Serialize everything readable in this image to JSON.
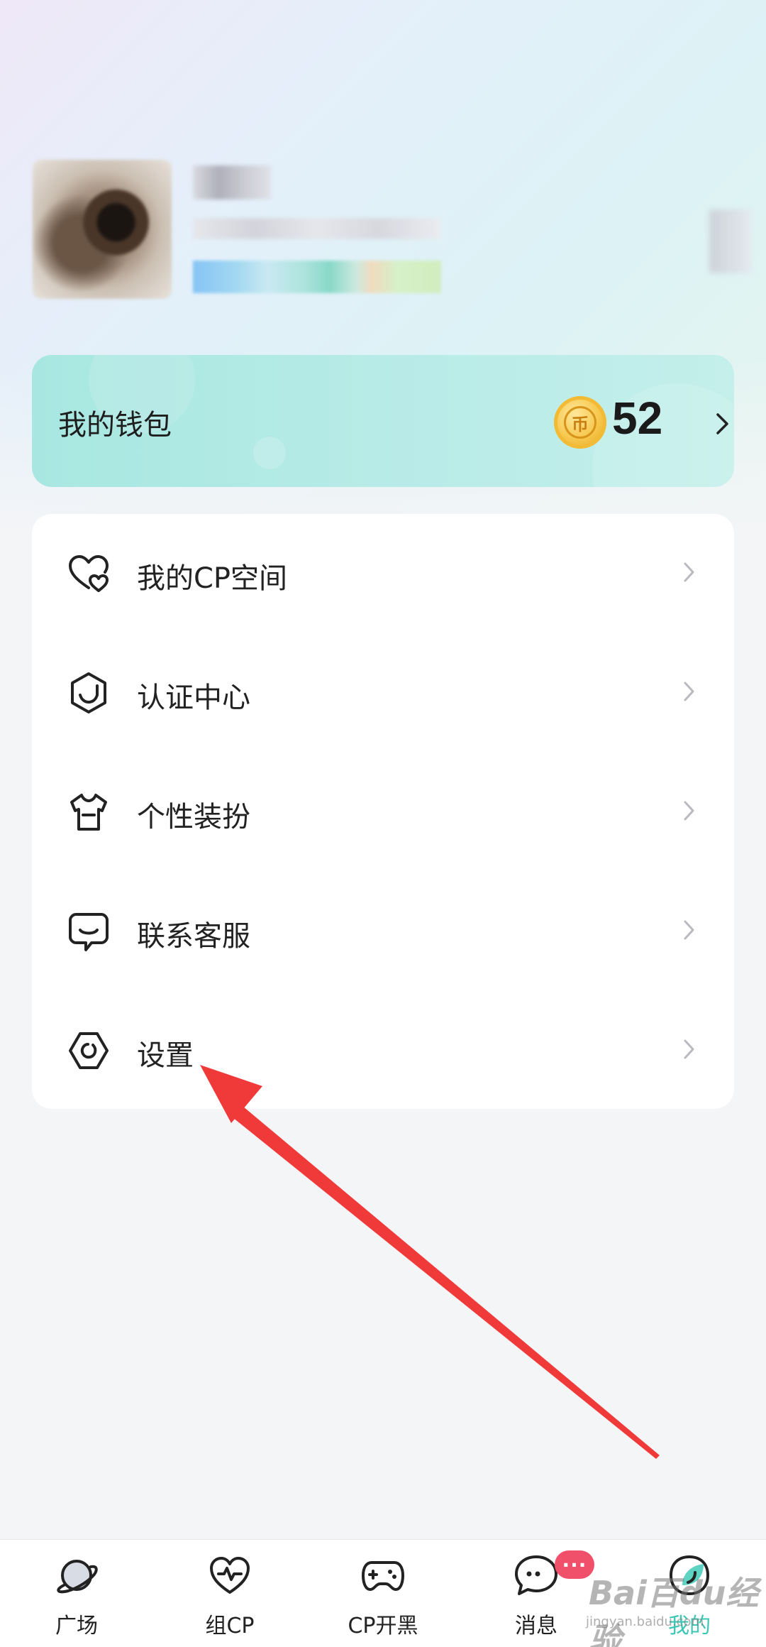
{
  "wallet": {
    "title": "我的钱包",
    "coin_symbol": "币",
    "coin_count": "52"
  },
  "menu": {
    "items": [
      {
        "label": "我的CP空间",
        "icon": "heart-icon"
      },
      {
        "label": "认证中心",
        "icon": "shield-icon"
      },
      {
        "label": "个性装扮",
        "icon": "tshirt-icon"
      },
      {
        "label": "联系客服",
        "icon": "chat-icon"
      },
      {
        "label": "设置",
        "icon": "gear-icon"
      }
    ]
  },
  "nav": {
    "items": [
      {
        "label": "广场",
        "icon": "planet-icon"
      },
      {
        "label": "组CP",
        "icon": "heartbeat-icon"
      },
      {
        "label": "CP开黑",
        "icon": "gamepad-icon"
      },
      {
        "label": "消息",
        "icon": "message-icon"
      },
      {
        "label": "我的",
        "icon": "profile-icon",
        "active": true
      }
    ],
    "badge": "···"
  },
  "watermark": {
    "text": "Bai百du经验",
    "sub": "jingyan.baidu.com"
  },
  "colors": {
    "accent": "#3cc6b4",
    "wallet_bg": "#b7ebe7",
    "annotation": "#f03a3a",
    "badge": "#f0506a"
  }
}
